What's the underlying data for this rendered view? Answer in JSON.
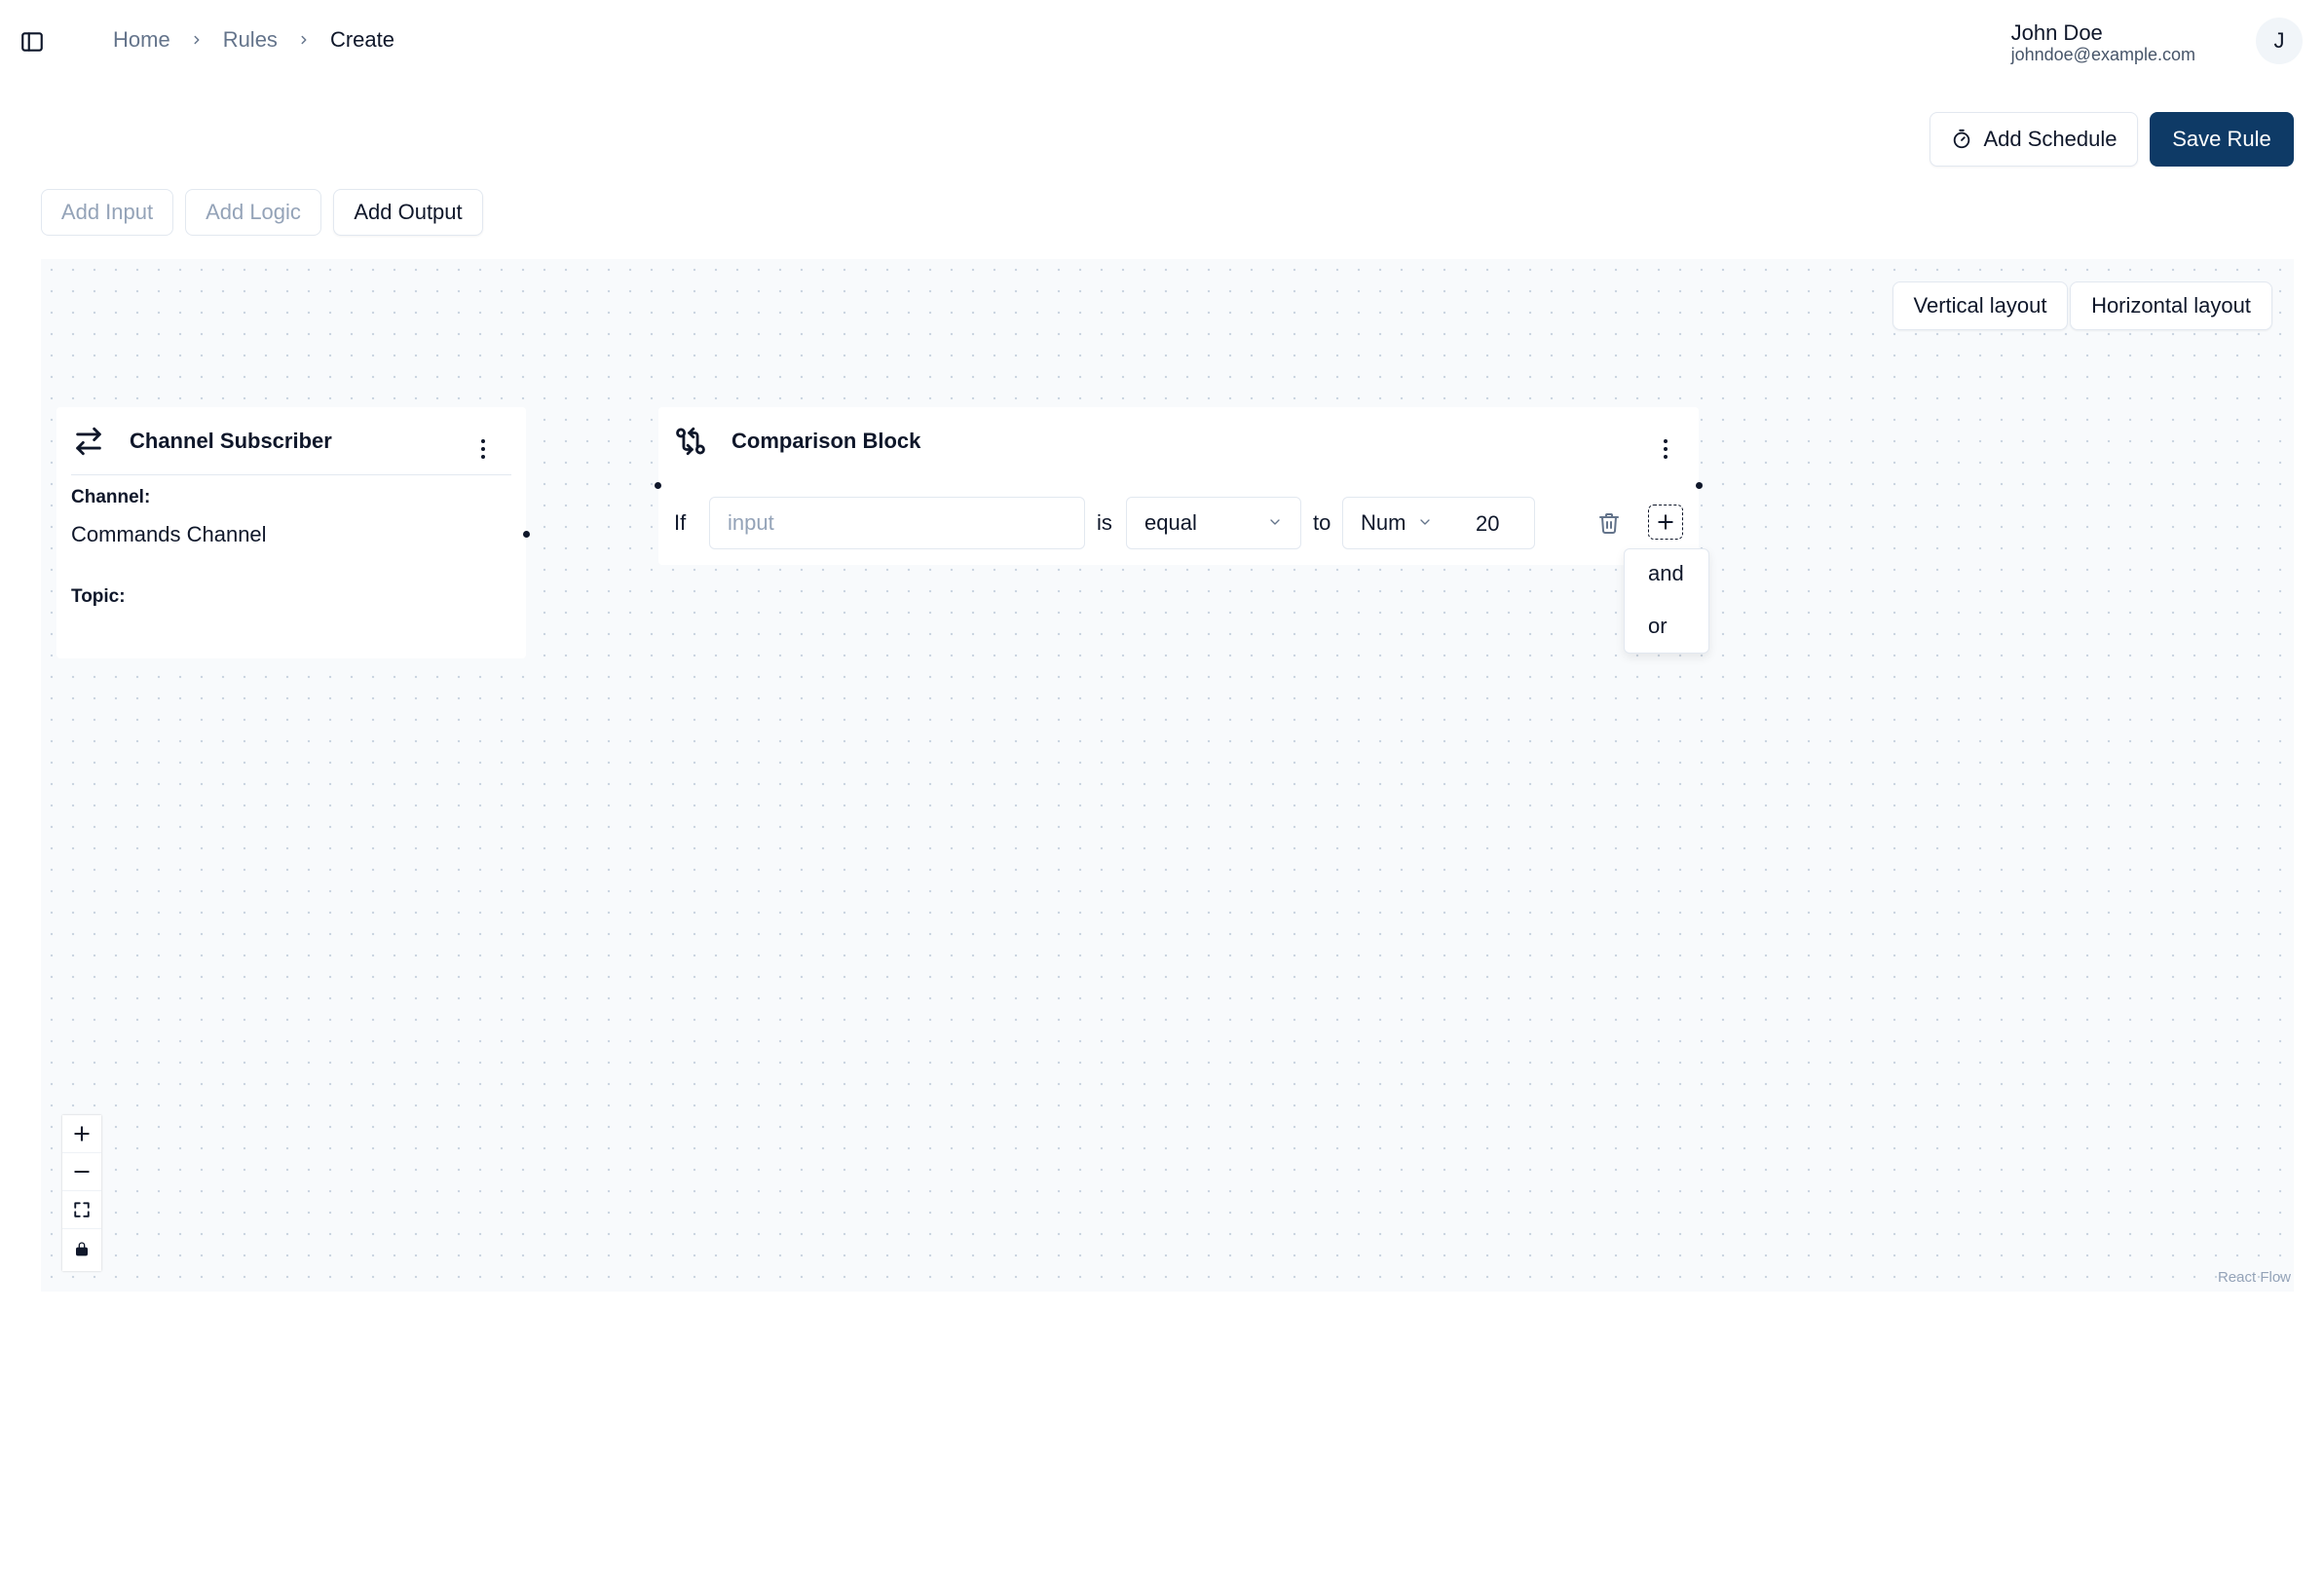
{
  "header": {
    "breadcrumb": [
      "Home",
      "Rules",
      "Create"
    ],
    "user": {
      "name": "John Doe",
      "email": "johndoe@example.com",
      "avatar_initial": "J"
    }
  },
  "actions": {
    "add_schedule_label": "Add Schedule",
    "save_rule_label": "Save Rule"
  },
  "toolbar": {
    "add_input_label": "Add Input",
    "add_logic_label": "Add Logic",
    "add_output_label": "Add Output"
  },
  "layout_buttons": {
    "vertical": "Vertical layout",
    "horizontal": "Horizontal layout"
  },
  "channel_node": {
    "title": "Channel Subscriber",
    "icon": "arrows-exchange-icon",
    "channel_label": "Channel:",
    "channel_value": "Commands Channel",
    "topic_label": "Topic:",
    "topic_value": ""
  },
  "comparison_node": {
    "title": "Comparison Block",
    "icon": "git-compare-icon",
    "if_label": "If",
    "input_placeholder": "input",
    "is_label": "is",
    "operator": "equal",
    "to_label": "to",
    "value_type": "Num",
    "value": "20"
  },
  "logic_menu": {
    "items": [
      "and",
      "or"
    ]
  },
  "canvas": {
    "attribution": "React Flow"
  },
  "colors": {
    "primary": "#0e3a66",
    "canvas_bg": "#f8fafc",
    "border": "#e2e8f0",
    "muted_text": "#64748b"
  }
}
